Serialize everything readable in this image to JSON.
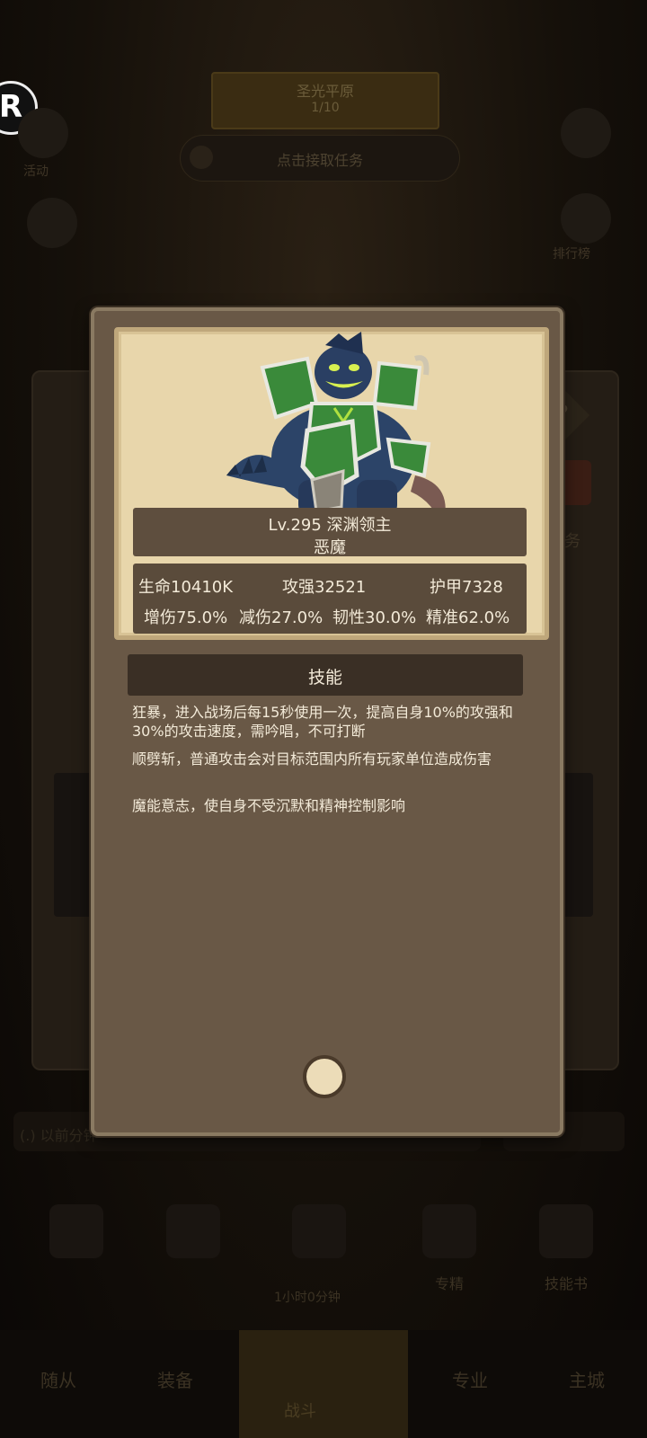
{
  "background": {
    "banner_title": "圣光平原",
    "banner_progress": "1/10",
    "task_prompt": "点击接取任务",
    "left_label": "活动",
    "right_label": "排行榜",
    "task_label": "任务",
    "status_text": "(.) 以前分钟",
    "timer_text": "1小时0分钟",
    "items": [
      {
        "label": ""
      },
      {
        "label": ""
      },
      {
        "label": ""
      },
      {
        "label": "专精"
      },
      {
        "label": "技能书"
      }
    ],
    "nav_tabs": [
      "随从",
      "装备",
      "战斗",
      "专业",
      "主城"
    ]
  },
  "monster": {
    "icon": "abyss-lord-portrait",
    "name_line": "Lv.295 深渊领主",
    "type": "恶魔",
    "stats": {
      "hp": "生命10410K",
      "attack": "攻强32521",
      "armor": "护甲7328",
      "dmg_up": "增伤75.0%",
      "dmg_down": "减伤27.0%",
      "tenacity": "韧性30.0%",
      "accuracy": "精准62.0%"
    }
  },
  "skills": {
    "header": "技能",
    "items": [
      "狂暴，进入战场后每15秒使用一次，提高自身10%的攻强和30%的攻击速度，需吟唱，不可打断",
      "顺劈斩，普通攻击会对目标范围内所有玩家单位造成伤害",
      "魔能意志，使自身不受沉默和精神控制影响"
    ]
  },
  "colors": {
    "card_bg": "#695846",
    "portrait_bg": "#e8d6ab",
    "text": "#f3ead8",
    "monster_armor": "#3a8a3a",
    "monster_skin": "#2c4468"
  }
}
